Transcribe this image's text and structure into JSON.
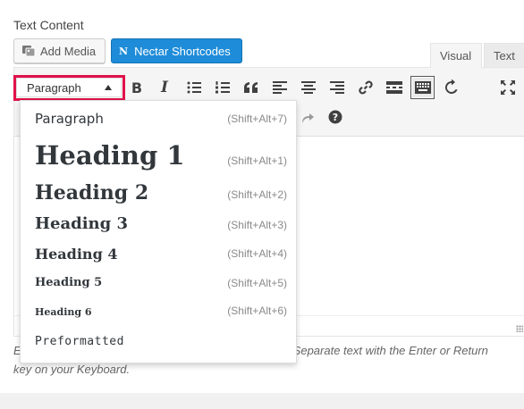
{
  "field": {
    "label": "Text Content"
  },
  "media_buttons": {
    "add_media": "Add Media",
    "nectar_icon": "N",
    "nectar": "Nectar Shortcodes"
  },
  "tabs": {
    "visual": "Visual",
    "text": "Text",
    "active": "visual"
  },
  "toolbar": {
    "format_select": {
      "selected": "Paragraph"
    },
    "bold_glyph": "B",
    "italic_glyph": "I",
    "buttons_row1": [
      "bold-button",
      "italic-button",
      "bulleted-list-button",
      "numbered-list-button",
      "blockquote-button",
      "align-left-button",
      "align-center-button",
      "align-right-button",
      "insert-link-button",
      "read-more-button",
      "toolbar-toggle-button",
      "refresh-button"
    ],
    "toolbar_toggle_active": true,
    "buttons_row1_right": [
      "fullscreen-button"
    ],
    "buttons_row2_visible": [
      "redo-button",
      "help-button"
    ]
  },
  "format_dropdown": {
    "items": [
      {
        "label": "Paragraph",
        "shortcut": "(Shift+Alt+7)"
      },
      {
        "label": "Heading 1",
        "shortcut": "(Shift+Alt+1)"
      },
      {
        "label": "Heading 2",
        "shortcut": "(Shift+Alt+2)"
      },
      {
        "label": "Heading 3",
        "shortcut": "(Shift+Alt+3)"
      },
      {
        "label": "Heading 4",
        "shortcut": "(Shift+Alt+4)"
      },
      {
        "label": "Heading 5",
        "shortcut": "(Shift+Alt+5)"
      },
      {
        "label": "Heading 6",
        "shortcut": "(Shift+Alt+6)"
      },
      {
        "label": "Preformatted",
        "shortcut": ""
      }
    ]
  },
  "help": {
    "line1_start": "E",
    "line1_end": "Separate text with the Enter or Return",
    "line2": "key on your Keyboard."
  },
  "colors": {
    "highlight": "#e0124a",
    "nectar_button": "#1e8cd8"
  }
}
